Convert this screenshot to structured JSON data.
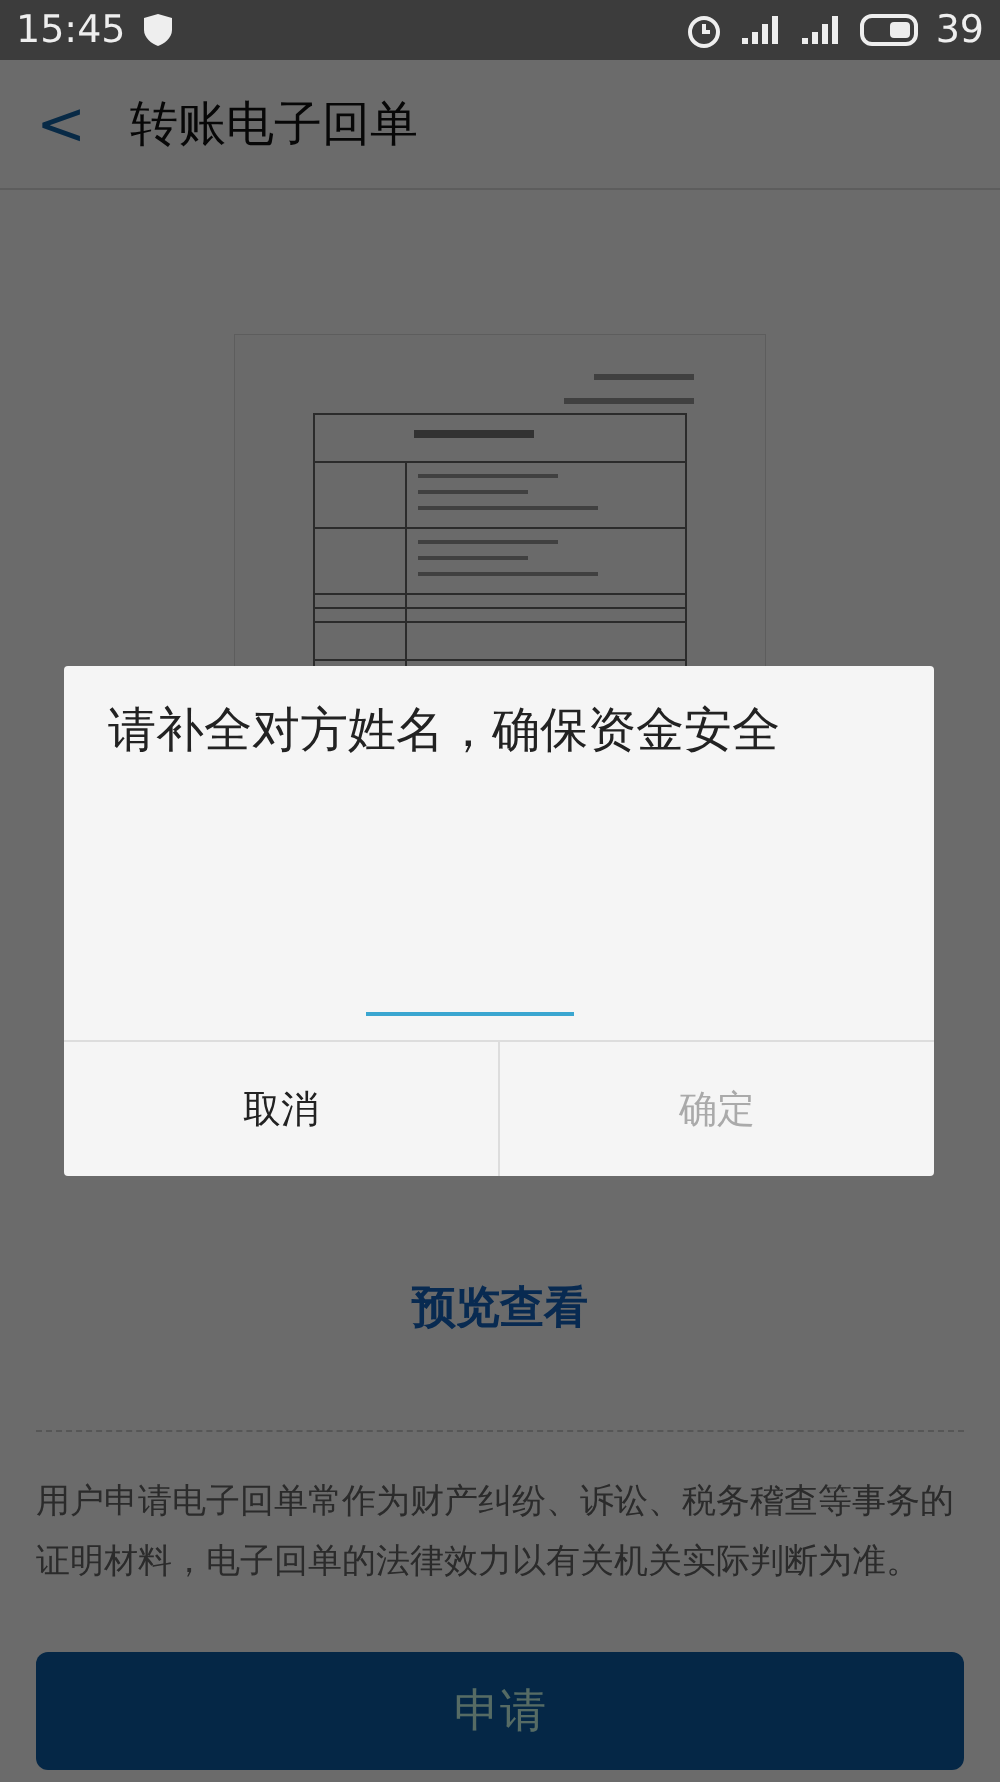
{
  "status_bar": {
    "time": "15:45",
    "battery": "39"
  },
  "header": {
    "back": "<",
    "title": "转账电子回单"
  },
  "preview_link": "预览查看",
  "notice": "用户申请电子回单常作为财产纠纷、诉讼、税务稽查等事务的证明材料，电子回单的法律效力以有关机关实际判断为准。",
  "apply_button": {
    "label": "申请"
  },
  "dialog": {
    "title": "请补全对方姓名，确保资金安全",
    "buttons": [
      {
        "label": "取消",
        "disabled": false
      },
      {
        "label": "确定",
        "disabled": true
      }
    ]
  }
}
